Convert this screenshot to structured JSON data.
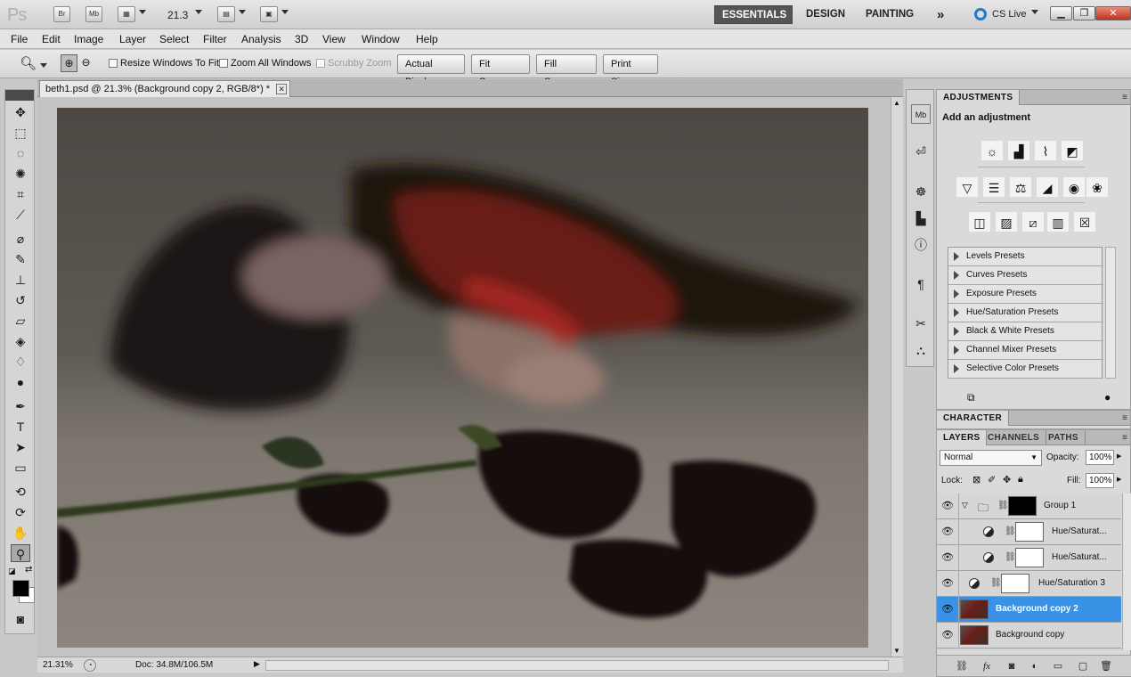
{
  "appbar": {
    "logo": "Ps",
    "bridge_label": "Br",
    "minibridge_label": "Mb",
    "zoom_level": "21.3",
    "workspaces": [
      "ESSENTIALS",
      "DESIGN",
      "PAINTING"
    ],
    "more_glyph": "»",
    "cslive": "CS Live"
  },
  "menu": [
    "File",
    "Edit",
    "Image",
    "Layer",
    "Select",
    "Filter",
    "Analysis",
    "3D",
    "View",
    "Window",
    "Help"
  ],
  "options": {
    "resize_windows": "Resize Windows To Fit",
    "zoom_all": "Zoom All Windows",
    "scrubby": "Scrubby Zoom",
    "actual_pixels": "Actual Pixels",
    "fit_screen": "Fit Screen",
    "fill_screen": "Fill Screen",
    "print_size": "Print Size"
  },
  "document": {
    "tab_title": "beth1.psd @ 21.3% (Background copy 2, RGB/8*) *",
    "zoom_field": "21.31%",
    "doc_size": "Doc: 34.8M/106.5M"
  },
  "adjustments": {
    "tab": "ADJUSTMENTS",
    "title": "Add an adjustment",
    "presets": [
      "Levels Presets",
      "Curves Presets",
      "Exposure Presets",
      "Hue/Saturation Presets",
      "Black & White Presets",
      "Channel Mixer Presets",
      "Selective Color Presets"
    ]
  },
  "character": {
    "tab": "CHARACTER"
  },
  "layers": {
    "tabs": [
      "LAYERS",
      "CHANNELS",
      "PATHS"
    ],
    "blend_mode": "Normal",
    "opacity_label": "Opacity:",
    "opacity_value": "100%",
    "lock_label": "Lock:",
    "fill_label": "Fill:",
    "fill_value": "100%",
    "items": [
      {
        "name": "Group 1"
      },
      {
        "name": "Hue/Saturat..."
      },
      {
        "name": "Hue/Saturat..."
      },
      {
        "name": "Hue/Saturation 3"
      },
      {
        "name": "Background copy 2"
      },
      {
        "name": "Background copy"
      }
    ],
    "selected_color": "#3a92e6"
  }
}
